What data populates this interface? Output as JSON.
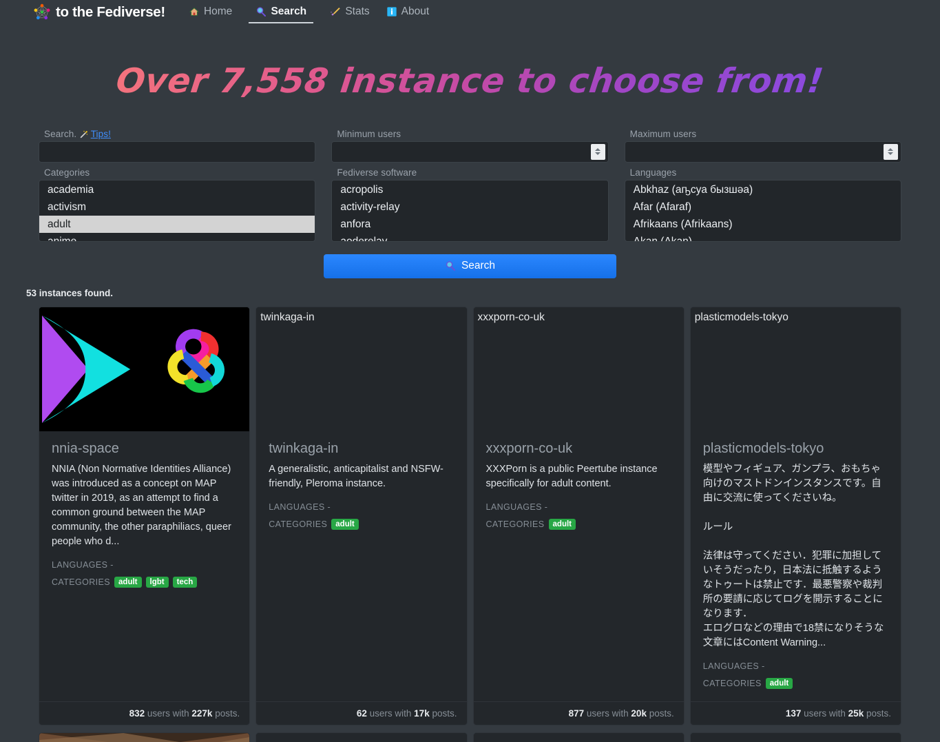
{
  "navbar": {
    "brand_text": "to the Fediverse!",
    "brand_icon": "fediverse-logo",
    "links": [
      {
        "label": "Home",
        "icon": "house-icon",
        "active": false
      },
      {
        "label": "Search",
        "icon": "magnifier-icon",
        "active": true
      },
      {
        "label": "Stats",
        "icon": "comet-icon",
        "active": false
      },
      {
        "label": "About",
        "icon": "info-icon",
        "active": false
      }
    ]
  },
  "hero": {
    "title": "Over 7,558 instance to choose from!",
    "instance_count": "7,558",
    "gradient_from": "#f4737d",
    "gradient_to": "#8a4ae0"
  },
  "form": {
    "search": {
      "label_prefix": "Search.",
      "tips_icon": "magic-wand-icon",
      "tips_label": "Tips!",
      "value": "",
      "placeholder": ""
    },
    "minimum_users": {
      "label": "Minimum users",
      "value": "",
      "placeholder": ""
    },
    "maximum_users": {
      "label": "Maximum users",
      "value": "",
      "placeholder": ""
    },
    "categories": {
      "label": "Categories",
      "options": [
        "academia",
        "activism",
        "adult",
        "anime"
      ],
      "selected": "adult"
    },
    "software": {
      "label": "Fediverse software",
      "options": [
        "acropolis",
        "activity-relay",
        "anfora",
        "aoderelay"
      ],
      "selected": ""
    },
    "languages": {
      "label": "Languages",
      "options": [
        "Abkhaz (аҧсуа бызшәа)",
        "Afar (Afaraf)",
        "Afrikaans (Afrikaans)",
        "Akan (Akan)"
      ],
      "selected": ""
    },
    "search_button": {
      "label": "Search",
      "icon": "magnifier-icon",
      "color": "#1778f2"
    }
  },
  "results": {
    "found_text": "53 instances found.",
    "count": 53,
    "badge_color": "#28a745",
    "cards": [
      {
        "alt": "nnia-space",
        "title": "nnia-space",
        "description": "NNIA (Non Normative Identities Alliance) was introduced as a concept on MAP twitter in 2019, as an attempt to find a common ground between the MAP community, the other paraphiliacs, queer people who d...",
        "languages_label": "LANGUAGES",
        "languages_value": "-",
        "categories_label": "CATEGORIES",
        "categories": [
          "adult",
          "lgbt",
          "tech"
        ],
        "users": "832",
        "users_suffix": "users with",
        "posts": "227k",
        "posts_suffix": "posts.",
        "has_banner_image": true
      },
      {
        "alt": "twinkaga-in",
        "title": "twinkaga-in",
        "description": "A generalistic, anticapitalist and NSFW-friendly, Pleroma instance.",
        "languages_label": "LANGUAGES",
        "languages_value": "-",
        "categories_label": "CATEGORIES",
        "categories": [
          "adult"
        ],
        "users": "62",
        "users_suffix": "users with",
        "posts": "17k",
        "posts_suffix": "posts.",
        "has_banner_image": false
      },
      {
        "alt": "xxxporn-co-uk",
        "title": "xxxporn-co-uk",
        "description": "XXXPorn is a public Peertube instance specifically for adult content.",
        "languages_label": "LANGUAGES",
        "languages_value": "-",
        "categories_label": "CATEGORIES",
        "categories": [
          "adult"
        ],
        "users": "877",
        "users_suffix": "users with",
        "posts": "20k",
        "posts_suffix": "posts.",
        "has_banner_image": false
      },
      {
        "alt": "plasticmodels-tokyo",
        "title": "plasticmodels-tokyo",
        "description": "模型やフィギュア、ガンプラ、おもちゃ向けのマストドンインスタンスです。自由に交流に使ってくださいね。\n\nルール\n\n法律は守ってください．犯罪に加担していそうだったり，日本法に抵触するようなトゥートは禁止です．最悪警察や裁判所の要請に応じてログを開示することになります．\nエログロなどの理由で18禁になりそうな文章にはContent Warning...",
        "languages_label": "LANGUAGES",
        "languages_value": "-",
        "categories_label": "CATEGORIES",
        "categories": [
          "adult"
        ],
        "users": "137",
        "users_suffix": "users with",
        "posts": "25k",
        "posts_suffix": "posts.",
        "has_banner_image": false
      }
    ]
  },
  "theme": {
    "page_bg": "#343a40",
    "card_bg": "#23272b",
    "input_bg": "#22262a",
    "muted_text": "#868e96",
    "accent_blue": "#1778f2"
  }
}
